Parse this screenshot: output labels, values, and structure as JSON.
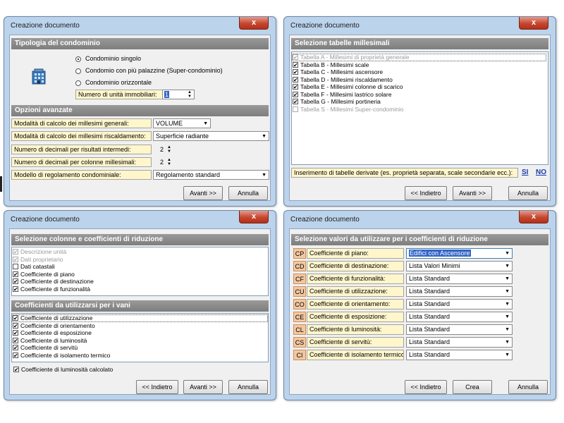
{
  "common": {
    "window_title": "Creazione documento",
    "close_glyph": "x",
    "back": "<< Indietro",
    "next": "Avanti >>",
    "cancel": "Annulla",
    "create": "Crea"
  },
  "w1": {
    "sec1": "Tipologia del condominio",
    "icon": "building-icon",
    "radios": [
      "Condominio singolo",
      "Condomio con più palazzine (Super-condominio)",
      "Condominio orizzontale"
    ],
    "selected_radio": 0,
    "units_label": "Numero di unità immobiliari:",
    "units_value": "1",
    "sec2": "Opzioni avanzate",
    "rows": [
      {
        "label": "Modalità di calcolo dei millesimi generali:",
        "value": "VOLUME"
      },
      {
        "label": "Modalità di calcolo dei millesimi riscaldamento:",
        "value": "Superficie radiante"
      },
      {
        "label": "Numero di decimali per risultati intermedi:",
        "value": "2"
      },
      {
        "label": "Numero di decimali per colonne millesimali:",
        "value": "2"
      },
      {
        "label": "Modello di regolamento condominiale:",
        "value": "Regolamento standard"
      }
    ]
  },
  "w2": {
    "sec": "Selezione tabelle millesimali",
    "items": [
      {
        "text": "Tabella A - Millesimi di proprietà generale",
        "checked": true,
        "disabled": true
      },
      {
        "text": "Tabella B - Millesimi scale",
        "checked": true,
        "disabled": false
      },
      {
        "text": "Tabella C - Millesimi ascensore",
        "checked": true,
        "disabled": false
      },
      {
        "text": "Tabella D - Millesimi riscaldamento",
        "checked": true,
        "disabled": false
      },
      {
        "text": "Tabella E - Millesimi colonne di scarico",
        "checked": true,
        "disabled": false
      },
      {
        "text": "Tabella F - Millesimi lastrico solare",
        "checked": true,
        "disabled": false
      },
      {
        "text": "Tabella G - Millesimi portineria",
        "checked": true,
        "disabled": false
      },
      {
        "text": "Tabella S - Millesimi Super-condominio",
        "checked": false,
        "disabled": true
      }
    ],
    "derived_label": "Inserimento di tabelle derivate (es. proprietà separata, scale secondarie ecc.):",
    "yes": "SI",
    "no": "NO"
  },
  "w3": {
    "sec1": "Selezione colonne e coefficienti di riduzione",
    "list1": [
      {
        "text": "Descrizione unità",
        "checked": true,
        "disabled": true
      },
      {
        "text": "Dati proprietario",
        "checked": true,
        "disabled": true
      },
      {
        "text": "Dati catastali",
        "checked": false,
        "disabled": false
      },
      {
        "text": "Coefficiente di piano",
        "checked": true,
        "disabled": false
      },
      {
        "text": "Coefficiente di destinazione",
        "checked": true,
        "disabled": false
      },
      {
        "text": "Coefficiente di funzionalità",
        "checked": true,
        "disabled": false
      }
    ],
    "sec2": "Coefficienti da utilizzarsi per i vani",
    "list2": [
      {
        "text": "Coefficiente di utilizzazione",
        "checked": true,
        "disabled": false
      },
      {
        "text": "Coefficiente di orientamento",
        "checked": true,
        "disabled": false
      },
      {
        "text": "Coefficiente di esposizione",
        "checked": true,
        "disabled": false
      },
      {
        "text": "Coefficiente di luminosità",
        "checked": true,
        "disabled": false
      },
      {
        "text": "Coefficiente di servitù",
        "checked": true,
        "disabled": false
      },
      {
        "text": "Coefficiente di isolamento termico",
        "checked": true,
        "disabled": false
      }
    ],
    "lum_calc": "Coefficiente di luminosità calcolato"
  },
  "w4": {
    "sec": "Selezione valori da utilizzare per i coefficienti di riduzione",
    "rows": [
      {
        "code": "CP",
        "label": "Coefficiente di piano:",
        "value": "Edifici con Ascensore"
      },
      {
        "code": "CD",
        "label": "Coefficiente di destinazione:",
        "value": "Lista Valori Minimi"
      },
      {
        "code": "CF",
        "label": "Coefficiente di funzionalità:",
        "value": "Lista Standard"
      },
      {
        "code": "CU",
        "label": "Coefficiente di utilizzazione:",
        "value": "Lista Standard"
      },
      {
        "code": "CO",
        "label": "Coefficiente di orientamento:",
        "value": "Lista Standard"
      },
      {
        "code": "CE",
        "label": "Coefficiente di esposizione:",
        "value": "Lista Standard"
      },
      {
        "code": "CL",
        "label": "Coefficiente di luminosità:",
        "value": "Lista Standard"
      },
      {
        "code": "CS",
        "label": "Coefficiente di servitù:",
        "value": "Lista Standard"
      },
      {
        "code": "CI",
        "label": "Coefficiente di isolamento termico:",
        "value": "Lista Standard"
      }
    ]
  }
}
